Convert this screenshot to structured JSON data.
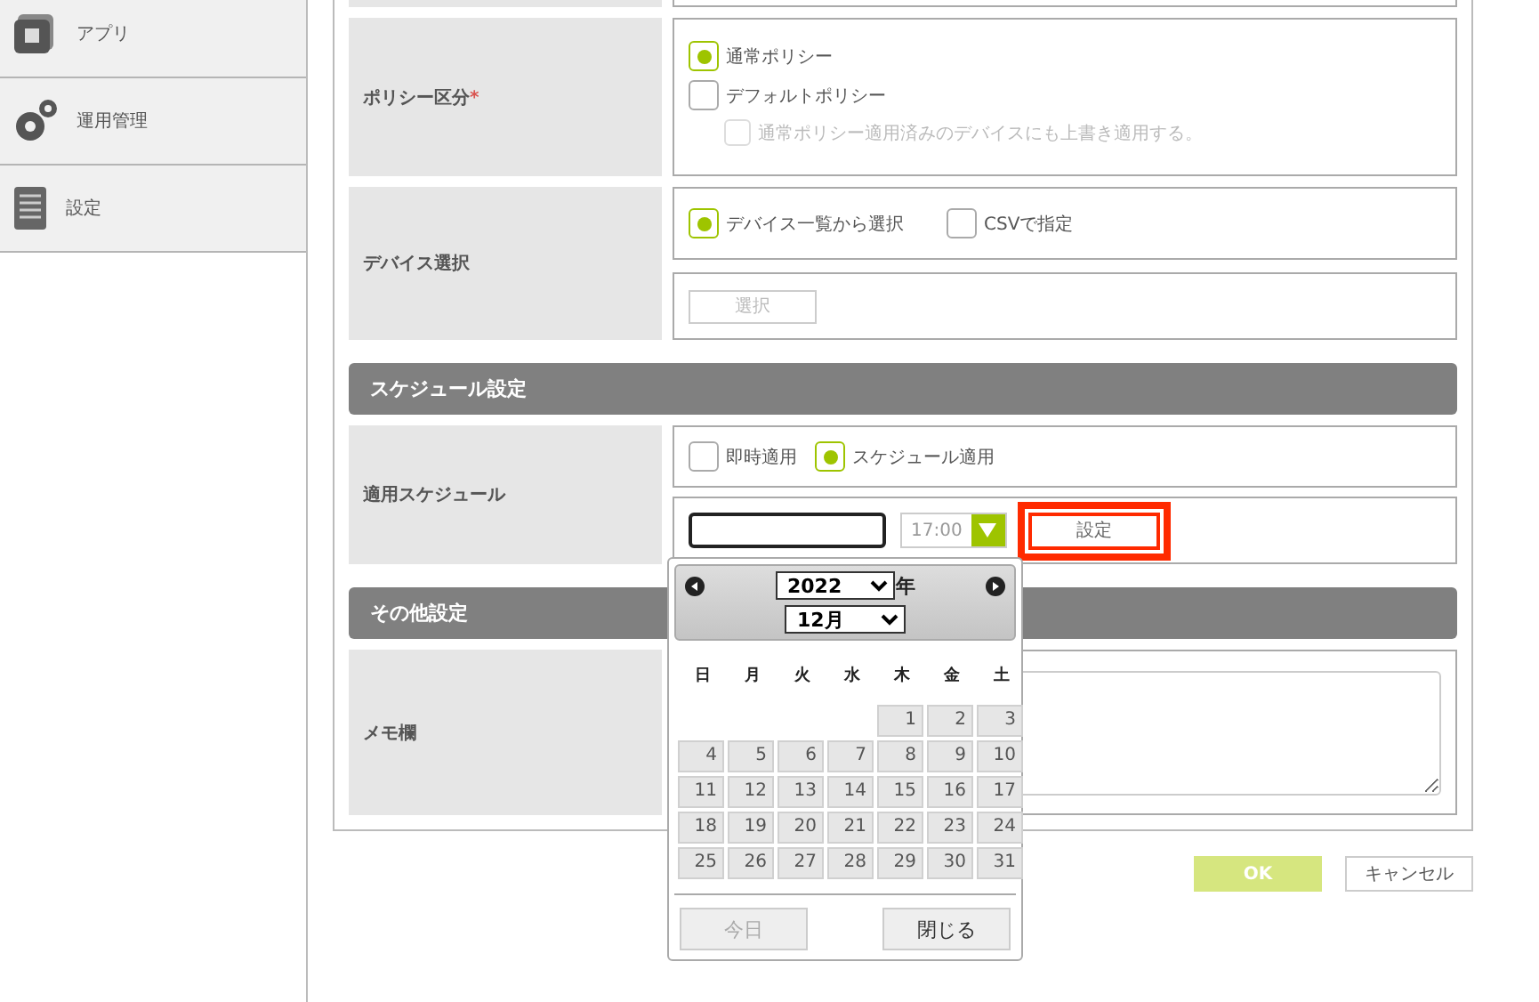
{
  "sidebar": {
    "items": [
      {
        "label": "アプリ",
        "kind": "apps"
      },
      {
        "label": "運用管理",
        "kind": "gears"
      },
      {
        "label": "設定",
        "kind": "document"
      }
    ]
  },
  "policy_type": {
    "label": "ポリシー区分",
    "required_mark": "*",
    "options": [
      {
        "label": "通常ポリシー",
        "selected": true
      },
      {
        "label": "デフォルトポリシー",
        "selected": false
      }
    ],
    "overwrite": {
      "label": "通常ポリシー適用済みのデバイスにも上書き適用する。",
      "checked": false,
      "disabled": true
    }
  },
  "device_selection": {
    "label": "デバイス選択",
    "options": [
      {
        "label": "デバイス一覧から選択",
        "selected": true
      },
      {
        "label": "CSVで指定",
        "selected": false
      }
    ],
    "select_button": {
      "label": "選択",
      "disabled": true
    }
  },
  "schedule_section": {
    "title": "スケジュール設定"
  },
  "schedule": {
    "label": "適用スケジュール",
    "options": [
      {
        "label": "即時適用",
        "selected": false
      },
      {
        "label": "スケジュール適用",
        "selected": true
      }
    ],
    "time": "17:00",
    "set_button": {
      "label": "設定",
      "highlighted": true
    }
  },
  "calendar": {
    "year": "2022",
    "year_suffix": "年",
    "month": "12月",
    "weekdays": [
      "日",
      "月",
      "火",
      "水",
      "木",
      "金",
      "土"
    ],
    "weeks": [
      [
        "1",
        "2",
        "3"
      ],
      [
        "4",
        "5",
        "6",
        "7",
        "8",
        "9",
        "10"
      ],
      [
        "11",
        "12",
        "13",
        "14",
        "15",
        "16",
        "17"
      ],
      [
        "18",
        "19",
        "20",
        "21",
        "22",
        "23",
        "24"
      ],
      [
        "25",
        "26",
        "27",
        "28",
        "29",
        "30",
        "31"
      ]
    ],
    "today_button": {
      "label": "今日",
      "disabled": true
    },
    "close_button": {
      "label": "閉じる",
      "disabled": false
    }
  },
  "other_section": {
    "title": "その他設定"
  },
  "memo": {
    "label": "メモ欄"
  },
  "buttons": [
    {
      "label": "OK",
      "kind": "primary"
    },
    {
      "label": "キャンセル",
      "kind": "secondary"
    }
  ]
}
